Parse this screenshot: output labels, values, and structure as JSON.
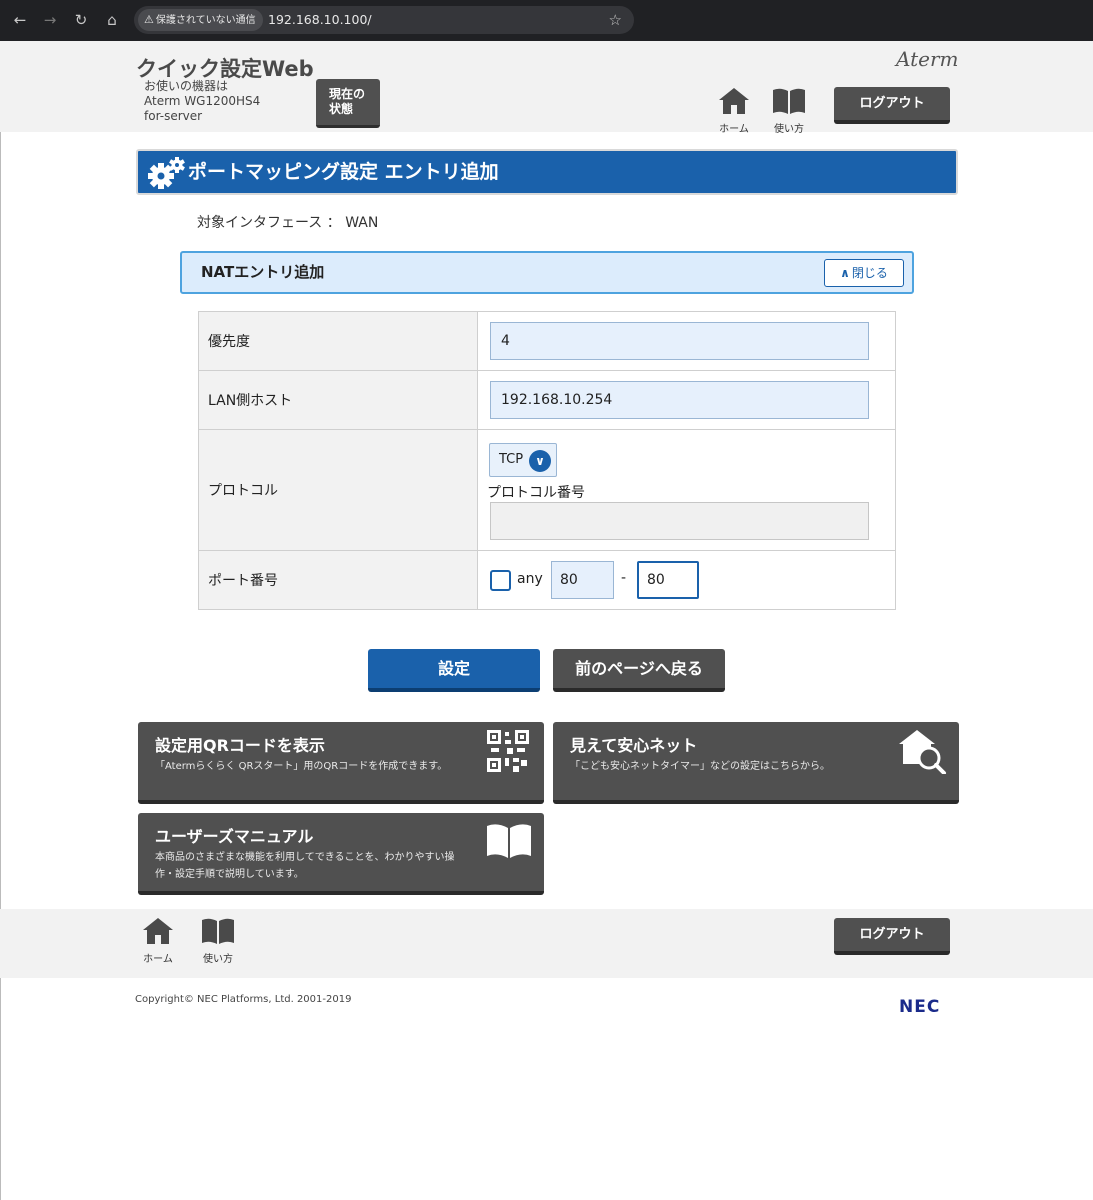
{
  "browser": {
    "security_chip": "保護されていない通信",
    "url": "192.168.10.100/"
  },
  "header": {
    "app_title": "クイック設定Web",
    "device_line1": "お使いの機器は",
    "device_line2": "Aterm WG1200HS4",
    "device_line3": "for-server",
    "status_btn_line1": "現在の",
    "status_btn_line2": "状態",
    "brand": "Aterm",
    "home_label": "ホーム",
    "manual_label": "使い方",
    "logout_label": "ログアウト"
  },
  "page": {
    "title": "ポートマッピング設定 エントリ追加",
    "target_interface": "対象インタフェース ： WAN"
  },
  "section": {
    "title": "NATエントリ追加",
    "close_label": "閉じる"
  },
  "form": {
    "priority_label": "優先度",
    "priority_value": "4",
    "lan_host_label": "LAN側ホスト",
    "lan_host_value": "192.168.10.254",
    "protocol_label": "プロトコル",
    "protocol_value": "TCP",
    "protocol_number_label": "プロトコル番号",
    "protocol_number_value": "",
    "port_label": "ポート番号",
    "any_label": "any",
    "port_from": "80",
    "port_dash": "-",
    "port_to": "80"
  },
  "actions": {
    "submit_label": "設定",
    "back_label": "前のページへ戻る"
  },
  "tiles": {
    "qr_title": "設定用QRコードを表示",
    "qr_desc": "「Atermらくらく QRスタート」用のQRコードを作成できます。",
    "safe_title": "見えて安心ネット",
    "safe_desc": "「こども安心ネットタイマー」などの設定はこちらから。",
    "manual_title": "ユーザーズマニュアル",
    "manual_desc_line1": "本商品のさまざまな機能を利用してできることを、わかりやすい操",
    "manual_desc_line2": "作・設定手順で説明しています。"
  },
  "footer": {
    "home_label": "ホーム",
    "manual_label": "使い方",
    "logout_label": "ログアウト",
    "copyright": "Copyright© NEC Platforms, Ltd. 2001-2019",
    "nec": "NEC"
  }
}
